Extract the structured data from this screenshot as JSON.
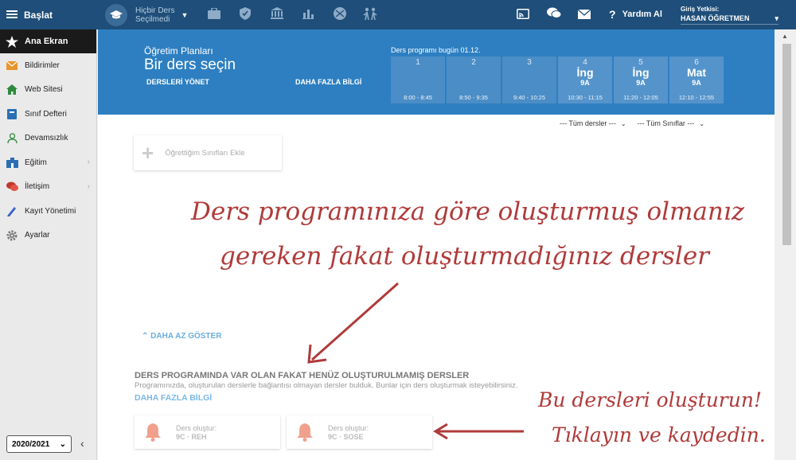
{
  "topbar": {
    "brand": "Başlat",
    "course_selector": {
      "line1": "Hiçbir Ders",
      "line2": "Seçilmedi"
    },
    "icons": [
      "briefcase-icon",
      "shield-icon",
      "institution-icon",
      "bar-chart-icon",
      "ball-icon",
      "people-icon"
    ],
    "help_label": "Yardım Al",
    "login_label": "Giriş Yetkisi:",
    "user_name": "HASAN ÖĞRETMEN"
  },
  "sidebar": {
    "items": [
      {
        "label": "Ana Ekran",
        "icon": "star-icon",
        "active": true
      },
      {
        "label": "Bildirimler",
        "icon": "envelope-icon"
      },
      {
        "label": "Web Sitesi",
        "icon": "house-icon"
      },
      {
        "label": "Sınıf Defteri",
        "icon": "notebook-icon"
      },
      {
        "label": "Devamsızlık",
        "icon": "person-icon"
      },
      {
        "label": "Eğitim",
        "icon": "school-icon",
        "has_submenu": true
      },
      {
        "label": "İletişim",
        "icon": "chat-icon",
        "has_submenu": true
      },
      {
        "label": "Kayıt Yönetimi",
        "icon": "pen-icon"
      },
      {
        "label": "Ayarlar",
        "icon": "gear-icon"
      }
    ],
    "year": "2020/2021"
  },
  "hero": {
    "subtitle": "Öğretim Planları",
    "title": "Bir ders seçin",
    "manage_link": "DERSLERİ YÖNET",
    "more_link": "DAHA FAZLA BİLGİ",
    "today_label": "Ders programı bugün 01.12.",
    "periods": [
      {
        "num": "1",
        "subject": "",
        "cls": "",
        "time": "8:00 - 8:45"
      },
      {
        "num": "2",
        "subject": "",
        "cls": "",
        "time": "8:50 - 9:35"
      },
      {
        "num": "3",
        "subject": "",
        "cls": "",
        "time": "9:40 - 10:25"
      },
      {
        "num": "4",
        "subject": "İng",
        "cls": "9A",
        "time": "10:30 - 11:15"
      },
      {
        "num": "5",
        "subject": "İng",
        "cls": "9A",
        "time": "11:20 - 12:05"
      },
      {
        "num": "6",
        "subject": "Mat",
        "cls": "9A",
        "time": "12:10 - 12:55"
      }
    ]
  },
  "filters": {
    "courses": "--- Tüm dersler ---",
    "classes": "--- Tüm Sınıflar ---"
  },
  "add_class_label": "Öğrettiğim Sınıfları Ekle",
  "show_less": "DAHA AZ GÖSTER",
  "uncreated": {
    "heading": "DERS PROGRAMINDA VAR OLAN FAKAT HENÜZ OLUŞTURULMAMIŞ DERSLER",
    "description": "Programınızda, oluşturulan derslerle bağlantısı olmayan dersler bulduk. Bunlar için ders oluşturmak isteyebilirsiniz.",
    "more": "DAHA FAZLA BİLGİ",
    "cards": [
      {
        "label": "Ders oluştur:",
        "course": "9C · REH"
      },
      {
        "label": "Ders oluştur:",
        "course": "9C · SOSE"
      }
    ]
  },
  "annotations": {
    "line1": "Ders programınıza göre oluşturmuş olmanız",
    "line2": "gereken fakat oluşturmadığınız dersler",
    "line3": "Bu dersleri oluşturun!",
    "line4": "Tıklayın ve kaydedin."
  },
  "colors": {
    "topbar": "#1e4e79",
    "hero": "#2d7fc1",
    "annotation": "#b03a3a",
    "bell": "#f0a08c"
  }
}
